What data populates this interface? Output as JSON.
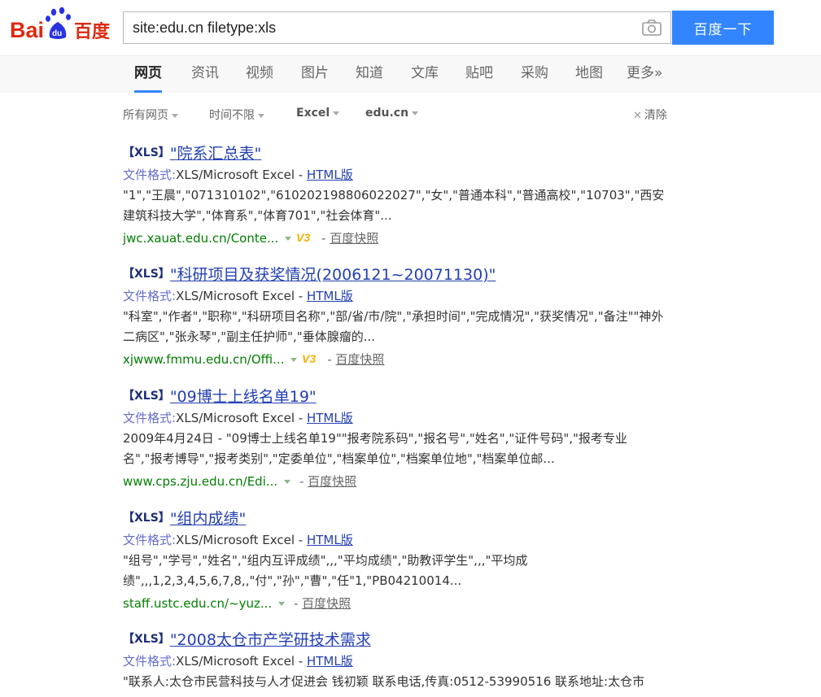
{
  "header": {
    "logo_text": "Baidu百度",
    "search_value": "site:edu.cn filetype:xls",
    "search_button": "百度一下"
  },
  "tabs": [
    "网页",
    "资讯",
    "视频",
    "图片",
    "知道",
    "文库",
    "贴吧",
    "采购",
    "地图",
    "更多»"
  ],
  "active_tab": "网页",
  "filters": {
    "all_pages": "所有网页",
    "time": "时间不限",
    "format": "Excel",
    "site": "edu.cn",
    "clear": "清除"
  },
  "common": {
    "tag": "【XLS】",
    "format_label": "文件格式:",
    "format_value": "XLS/Microsoft Excel - ",
    "html_version": "HTML版",
    "cache_separator": " - ",
    "cache": "百度快照"
  },
  "results": [
    {
      "title": "\"院系汇总表\"",
      "snippet": "\"1\",\"王晨\",\"071310102\",\"610202198806022027\",\"女\",\"普通本科\",\"普通高校\",\"10703\",\"西安建筑科技大学\",\"体育系\",\"体育701\",\"社会体育\"...",
      "url": "jwc.xauat.edu.cn/Conte...",
      "badge": "V3"
    },
    {
      "title": "\"科研项目及获奖情况(2006121~20071130)\"",
      "snippet": "\"科室\",\"作者\",\"职称\",\"科研项目名称\",\"部/省/市/院\",\"承担时间\",\"完成情况\",\"获奖情况\",\"备注\"\"神外二病区\",\"张永琴\",\"副主任护师\",\"垂体腺瘤的...",
      "url": "xjwww.fmmu.edu.cn/Offi...",
      "badge": "V3"
    },
    {
      "title": "\"09博士上线名单19\"",
      "snippet": "2009年4月24日 - \"09博士上线名单19\"\"报考院系码\",\"报名号\",\"姓名\",\"证件号码\",\"报考专业名\",\"报考博导\",\"报考类别\",\"定委单位\",\"档案单位\",\"档案单位地\",\"档案单位邮...",
      "url": "www.cps.zju.edu.cn/Edi...",
      "badge": ""
    },
    {
      "title": "\"组内成绩\"",
      "snippet": "\"组号\",\"学号\",\"姓名\",\"组内互评成绩\",,,\"平均成绩\",\"助教评学生\",,,\"平均成绩\",,,1,2,3,4,5,6,7,8,,\"付\",\"孙\",\"曹\",\"任\"1,\"PB04210014...",
      "url": "staff.ustc.edu.cn/~yuz...",
      "badge": ""
    },
    {
      "title": "\"2008太仓市产学研技术需求",
      "snippet": "\"联系人:太仓市民营科技与人才促进会 钱初颖 联系电话,传真:0512-53990516 联系地址:太仓市",
      "url": "",
      "badge": ""
    }
  ]
}
